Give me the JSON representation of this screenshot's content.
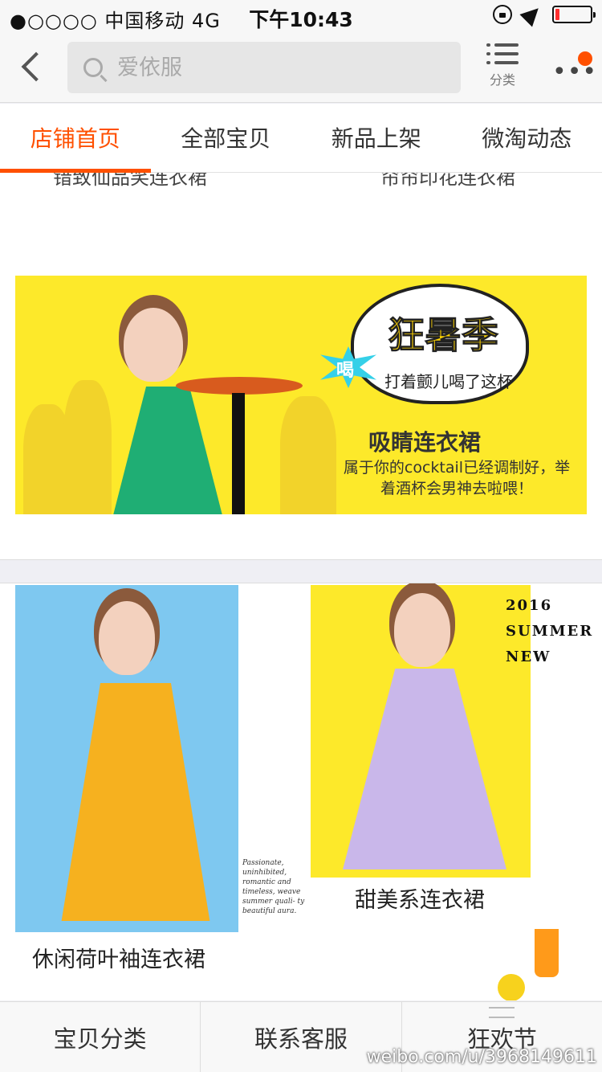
{
  "status_bar": {
    "carrier": "●○○○○ 中国移动   4G",
    "time": "下午10:43",
    "battery_level": 0.12
  },
  "header": {
    "search_placeholder": "爱依服",
    "category_label": "分类",
    "more_dots": "•••"
  },
  "tabs": [
    {
      "label": "店铺首页",
      "active": true
    },
    {
      "label": "全部宝贝",
      "active": false
    },
    {
      "label": "新品上架",
      "active": false
    },
    {
      "label": "微淘动态",
      "active": false
    }
  ],
  "clipped_captions": [
    "错致仙品笑连衣裙",
    "帘帘印花连衣裙"
  ],
  "banner": {
    "bubble_title": "狂暑季",
    "bubble_burst": "喝",
    "bubble_sub": "打着颤儿喝了这杯",
    "headline": "吸睛连衣裙",
    "description": "属于你的cocktail已经调制好，举着酒杯会男神去啦喂！"
  },
  "products": {
    "left_label": "休闲荷叶袖连衣裙",
    "left_note": "Passionate, uninhibited, romantic and timeless, weave summer quali- ty beautiful aura.",
    "right_label": "甜美系连衣裙",
    "summer_line1": "2016",
    "summer_line2": "SUMMER",
    "summer_line3": "NEW"
  },
  "bottom_bar": [
    "宝贝分类",
    "联系客服",
    "狂欢节"
  ],
  "watermark": "weibo.com/u/3968149611",
  "colors": {
    "accent": "#ff5000",
    "banner_yellow": "#fde92a",
    "sky_blue": "#7ec8f0"
  }
}
